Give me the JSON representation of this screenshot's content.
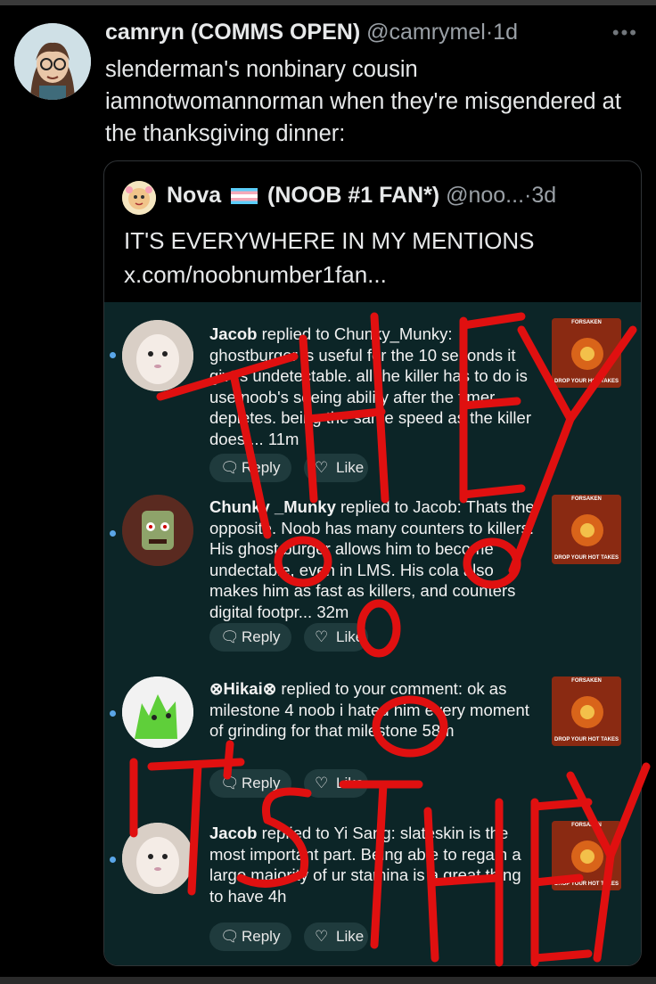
{
  "tweet": {
    "author_name": "camryn (COMMS OPEN)",
    "handle": "@camrymel",
    "separator": "·",
    "time": "1d",
    "more_icon": "more-icon",
    "text": "slenderman's nonbinary cousin iamnotwomannorman when they're misgendered at the thanksgiving dinner:"
  },
  "quote": {
    "author_name": "Nova",
    "author_name_suffix": "(NOOB #1 FAN*)",
    "handle": "@noo...",
    "separator": "·",
    "time": "3d",
    "text_line1": "IT'S EVERYWHERE IN MY MENTIONS",
    "text_line2": "x.com/noobnumber1fan..."
  },
  "replies": [
    {
      "author": "Jacob",
      "text": " replied to Chunky_Munky: ghostburger is useful for the 10 seconds it gives undetectable. all the killer has to do is use noob's seeing ability after the timer depletes. being the same speed as the killer does ...",
      "time": "11m",
      "reply_label": "Reply",
      "like_label": "Like",
      "thumb_top": "FORSAKEN",
      "thumb_bottom": "DROP YOUR HOT TAKES"
    },
    {
      "author": "Chunky _Munky",
      "text": " replied to Jacob: Thats the opposite. Noob has many counters to killers. His ghost burger allows him to become undectable, even in LMS. His cola also makes him as fast as killers, and counters digital footpr...",
      "time": "32m",
      "reply_label": "Reply",
      "like_label": "Like",
      "thumb_top": "FORSAKEN",
      "thumb_bottom": "DROP YOUR HOT TAKES"
    },
    {
      "author": "⊗Hikai⊗",
      "text": " replied to your comment: ok as milestone 4 noob i hated him every moment of grinding for that milestone",
      "time": "58m",
      "reply_label": "Reply",
      "like_label": "Like",
      "thumb_top": "FORSAKEN",
      "thumb_bottom": "DROP YOUR HOT TAKES"
    },
    {
      "author": "Jacob",
      "text": " replied to Yi Sang: slateskin is the most important part. Being able to regain a large majority of ur stamina is a great thing to have",
      "time": "4h",
      "reply_label": "Reply",
      "like_label": "Like",
      "thumb_top": "FORSAKEN",
      "thumb_bottom": "DROP YOUR HOT TAKES"
    }
  ],
  "overlay": {
    "scribble_top": "THEY",
    "scribble_bottom": "IT'S THEY",
    "color": "#e01010"
  },
  "colors": {
    "background": "#000000",
    "screenshot_bg": "#0c2527",
    "button_bg": "#1f3b3d",
    "muted_text": "#9aa0a6",
    "unread_dot": "#5aa6e8"
  }
}
